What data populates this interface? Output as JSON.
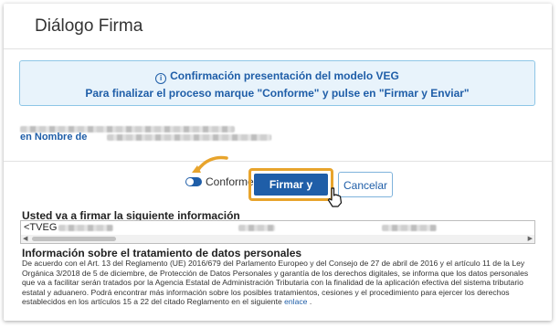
{
  "dialog": {
    "title": "Diálogo Firma",
    "info": {
      "icon": "info-circle-icon",
      "line1": "Confirmación presentación del modelo VEG",
      "line2": "Para finalizar el proceso marque \"Conforme\" y pulse en \"Firmar y Enviar\""
    },
    "en_nombre_label": "en Nombre de",
    "conforme_label": "Conforme",
    "conforme_checked": true,
    "buttons": {
      "firmar": "Firmar y Enviar",
      "cancelar": "Cancelar"
    },
    "firmar_heading": "Usted va a firmar la siguiente información",
    "data_prefix": "<TVEG",
    "privacy": {
      "heading": "Información sobre el tratamiento de datos personales",
      "text": "De acuerdo con el Art. 13 del Reglamento (UE) 2016/679 del Parlamento Europeo y del Consejo de 27 de abril de 2016 y el artículo 11 de la Ley Orgánica 3/2018 de 5 de diciembre, de Protección de Datos Personales y garantía de los derechos digitales, se informa que los datos personales que va a facilitar serán tratados por la Agencia Estatal de Administración Tributaria con la finalidad de la aplicación efectiva del sistema tributario estatal y aduanero. Podrá encontrar más información sobre los posibles tratamientos, cesiones y el procedimiento para ejercer los derechos establecidos en los artículos 15 a 22 del citado Reglamento en el siguiente",
      "link": "enlace",
      "end": "."
    },
    "colors": {
      "accent": "#1f5ea8",
      "info_bg": "#e8f3fb",
      "highlight": "#e8a42c"
    }
  }
}
